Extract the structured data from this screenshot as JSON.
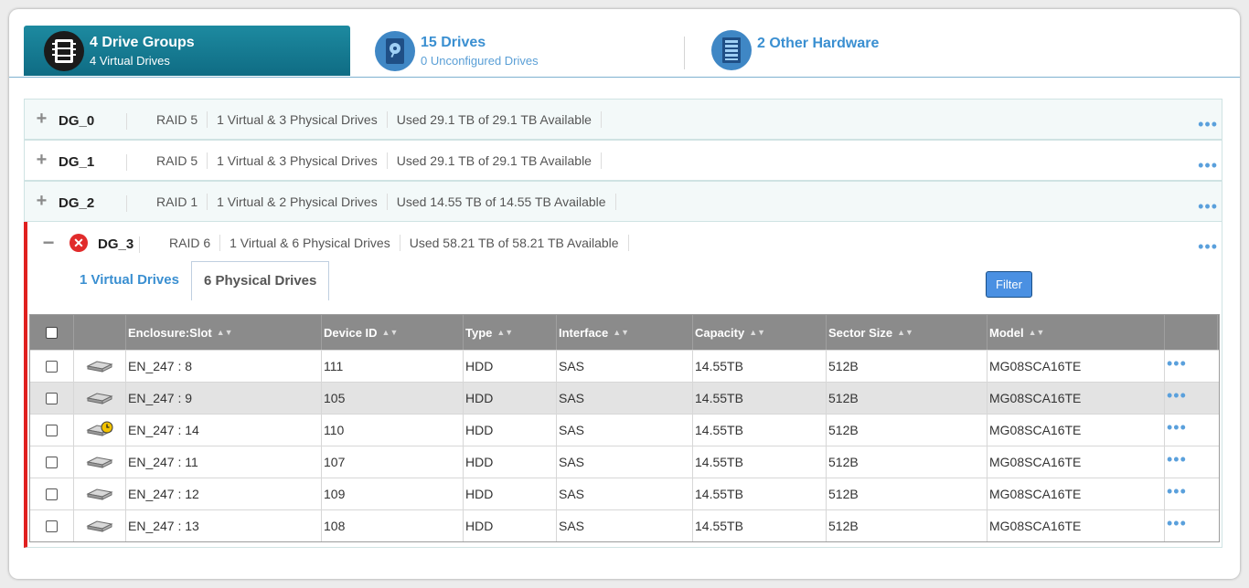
{
  "summary": {
    "drive_groups": {
      "title": "4 Drive Groups",
      "subtitle": "4 Virtual Drives",
      "icon": "drive-group-icon"
    },
    "drives": {
      "title": "15 Drives",
      "subtitle": "0 Unconfigured Drives",
      "icon": "drive-icon"
    },
    "other_hardware": {
      "title": "2 Other Hardware",
      "subtitle": "",
      "icon": "hardware-icon"
    }
  },
  "groups": [
    {
      "name": "DG_0",
      "raid": "RAID 5",
      "drives": "1 Virtual & 3 Physical Drives",
      "usage": "Used 29.1 TB of 29.1 TB Available",
      "expander": "+"
    },
    {
      "name": "DG_1",
      "raid": "RAID 5",
      "drives": "1 Virtual & 3 Physical Drives",
      "usage": "Used 29.1 TB of 29.1 TB Available",
      "expander": "+"
    },
    {
      "name": "DG_2",
      "raid": "RAID 1",
      "drives": "1 Virtual & 2 Physical Drives",
      "usage": "Used 14.55 TB of 14.55 TB Available",
      "expander": "+"
    }
  ],
  "expanded_group": {
    "name": "DG_3",
    "expander": "−",
    "status_icon": "error-icon",
    "raid": "RAID 6",
    "drives": "1 Virtual & 6 Physical Drives",
    "usage": "Used 58.21 TB of 58.21 TB Available",
    "tabs": [
      "1 Virtual Drives",
      "6 Physical Drives"
    ],
    "active_tab": "6 Physical Drives",
    "filter_label": "Filter"
  },
  "table": {
    "columns": [
      "Enclosure:Slot",
      "Device ID",
      "Type",
      "Interface",
      "Capacity",
      "Sector Size",
      "Model"
    ],
    "rows": [
      {
        "slot": "EN_247 : 8",
        "device_id": "111",
        "type": "HDD",
        "interface": "SAS",
        "capacity": "14.55TB",
        "sector": "512B",
        "model": "MG08SCA16TE",
        "icon": "hdd-icon"
      },
      {
        "slot": "EN_247 : 9",
        "device_id": "105",
        "type": "HDD",
        "interface": "SAS",
        "capacity": "14.55TB",
        "sector": "512B",
        "model": "MG08SCA16TE",
        "icon": "hdd-icon"
      },
      {
        "slot": "EN_247 : 14",
        "device_id": "110",
        "type": "HDD",
        "interface": "SAS",
        "capacity": "14.55TB",
        "sector": "512B",
        "model": "MG08SCA16TE",
        "icon": "hdd-rebuilding-icon"
      },
      {
        "slot": "EN_247 : 11",
        "device_id": "107",
        "type": "HDD",
        "interface": "SAS",
        "capacity": "14.55TB",
        "sector": "512B",
        "model": "MG08SCA16TE",
        "icon": "hdd-icon"
      },
      {
        "slot": "EN_247 : 12",
        "device_id": "109",
        "type": "HDD",
        "interface": "SAS",
        "capacity": "14.55TB",
        "sector": "512B",
        "model": "MG08SCA16TE",
        "icon": "hdd-icon"
      },
      {
        "slot": "EN_247 : 13",
        "device_id": "108",
        "type": "HDD",
        "interface": "SAS",
        "capacity": "14.55TB",
        "sector": "512B",
        "model": "MG08SCA16TE",
        "icon": "hdd-icon"
      }
    ]
  },
  "colors": {
    "accent": "#1d8aa0",
    "link": "#3a8fd1",
    "error": "#e0201f",
    "header_gray": "#8b8b8b"
  }
}
